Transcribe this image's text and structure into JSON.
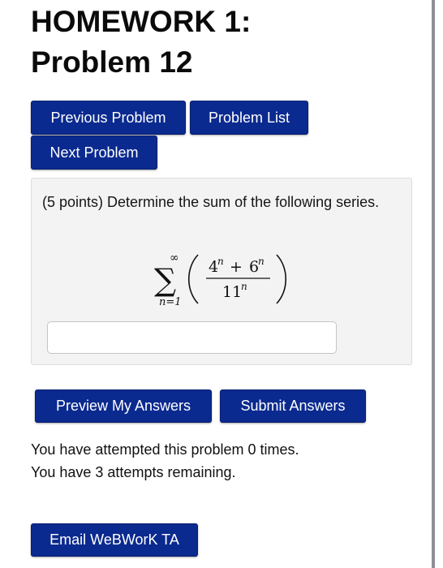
{
  "page": {
    "title_line1": "HOMEWORK 1:",
    "title_line2": "Problem 12"
  },
  "nav": {
    "previous_label": "Previous Problem",
    "list_label": "Problem List",
    "next_label": "Next Problem"
  },
  "problem": {
    "points_text": "(5 points) Determine the sum of the following series.",
    "math": {
      "operator": "∑",
      "upper_limit": "∞",
      "lower_limit": "n=1",
      "numerator_term1_base": "4",
      "numerator_operator": "+",
      "numerator_term2_base": "6",
      "denominator_base": "11",
      "exponent": "n"
    },
    "answer": {
      "value": "",
      "placeholder": ""
    }
  },
  "actions": {
    "preview_label": "Preview My Answers",
    "submit_label": "Submit Answers"
  },
  "status": {
    "attempted_text": "You have attempted this problem 0 times.",
    "remaining_text": "You have 3 attempts remaining."
  },
  "footer": {
    "email_label": "Email WeBWorK TA"
  },
  "colors": {
    "button_background": "#0b2a8f",
    "button_text": "#ffffff",
    "problem_background": "#f3f3f3"
  }
}
